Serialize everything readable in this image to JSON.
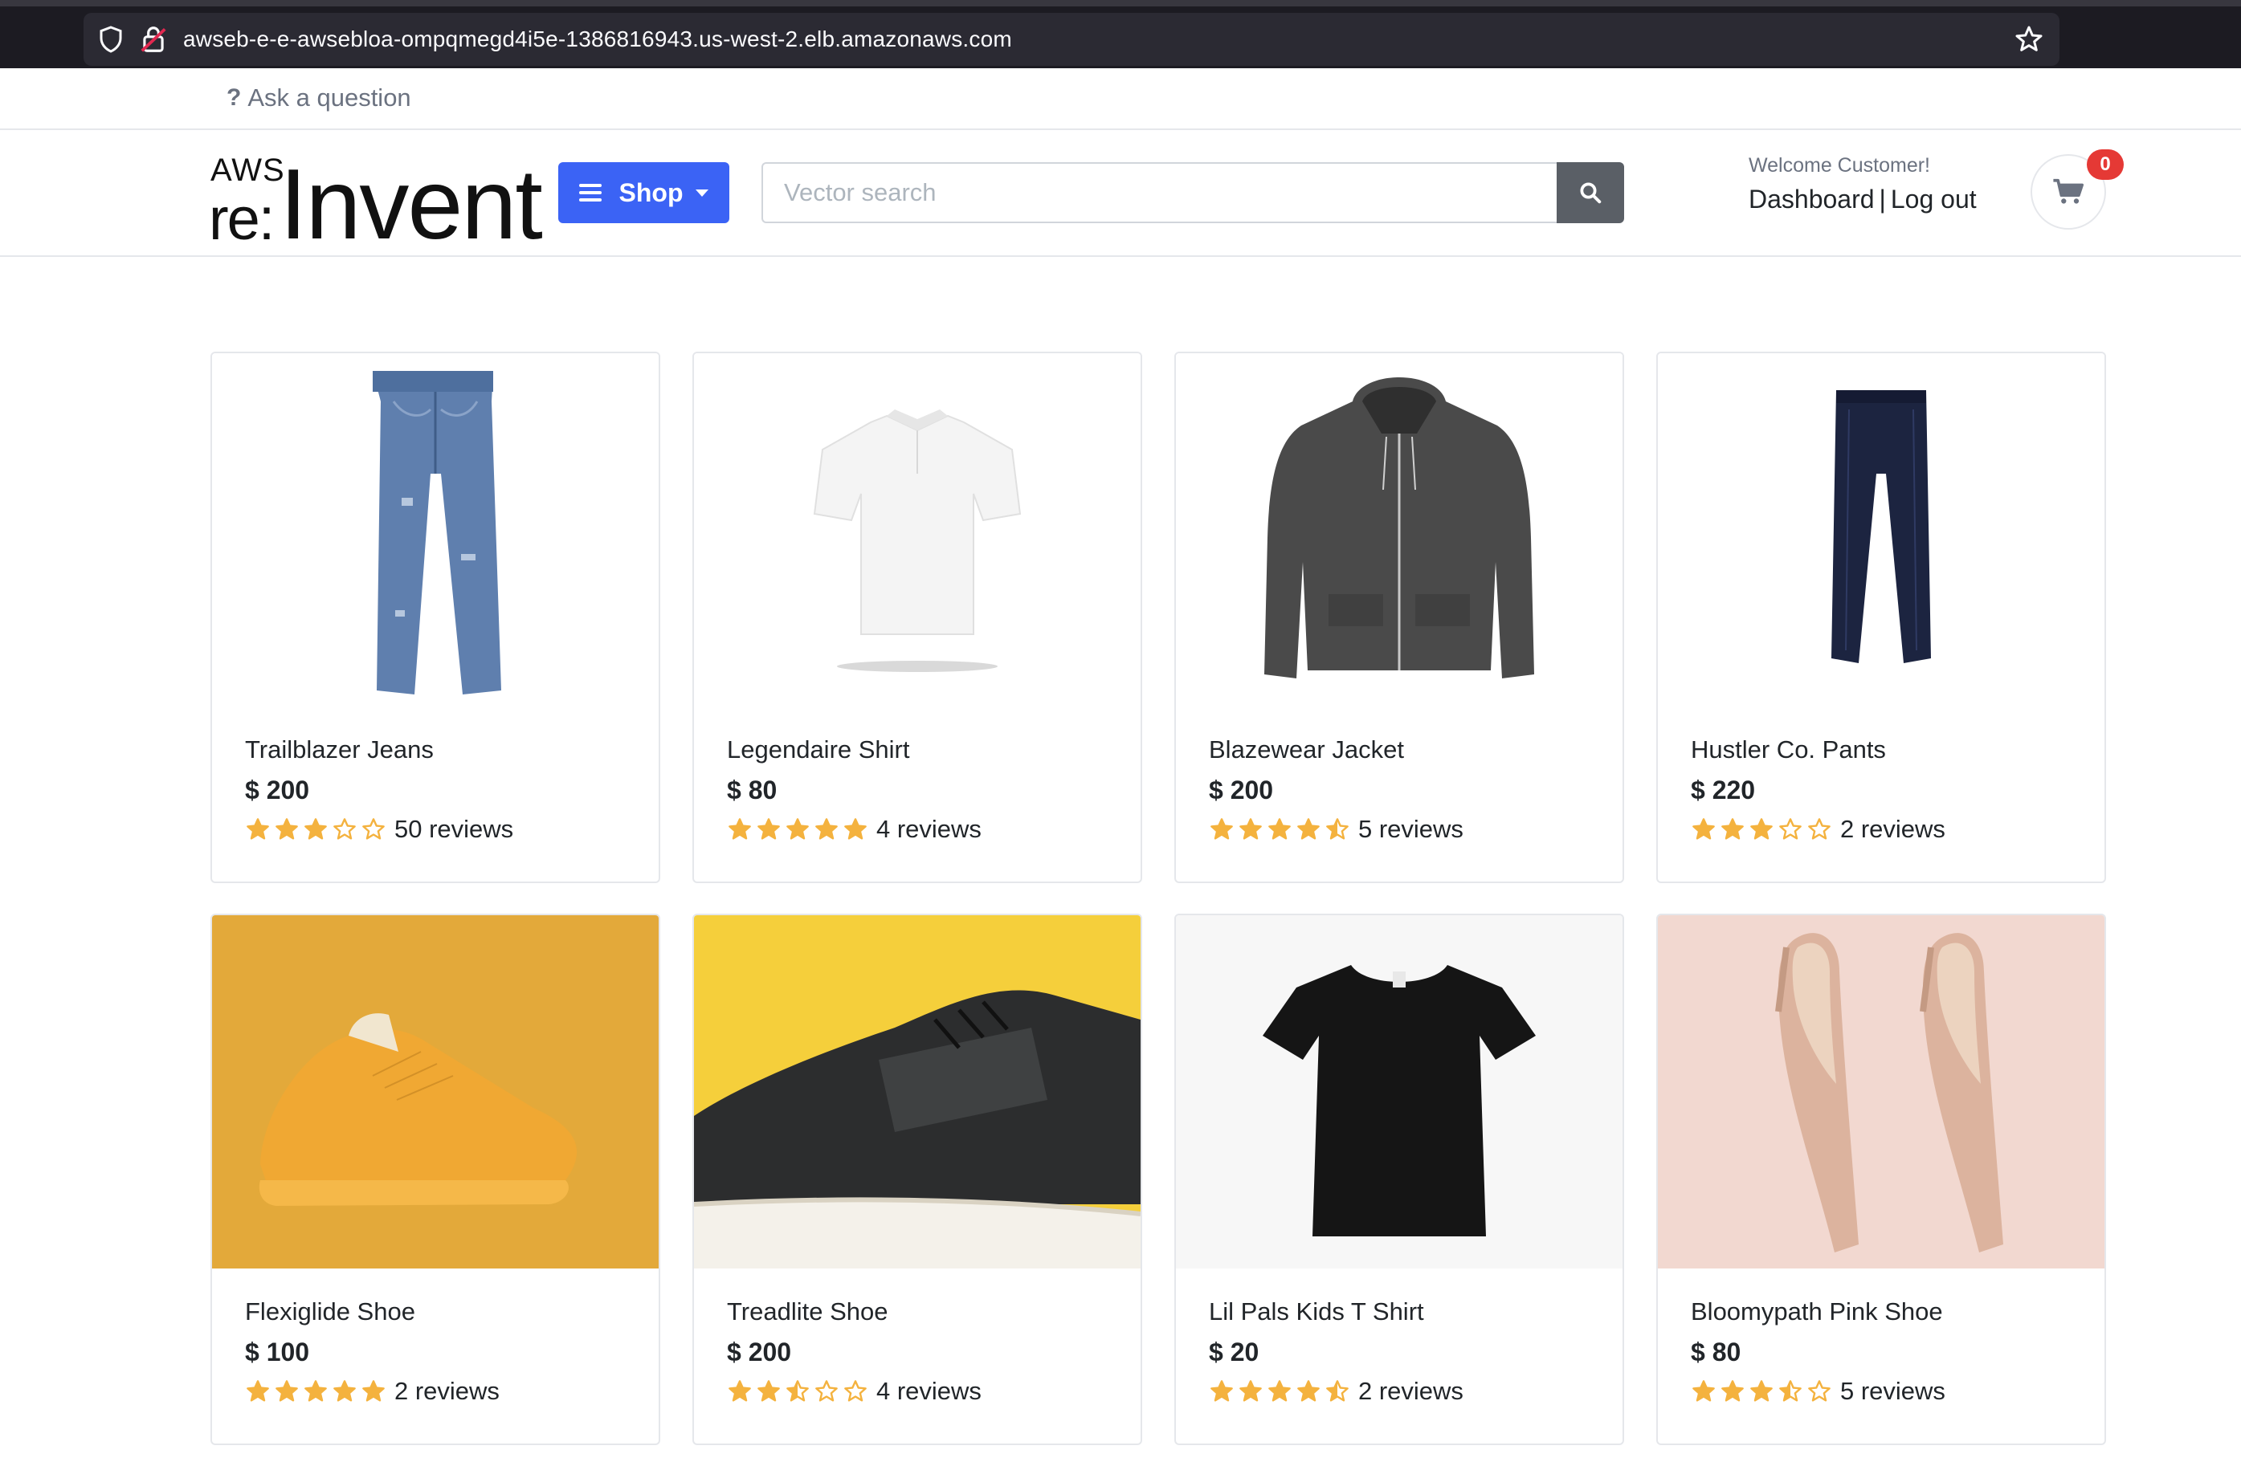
{
  "browser": {
    "url": "awseb-e-e-awsebloa-ompqmegd4i5e-1386816943.us-west-2.elb.amazonaws.com"
  },
  "topbar": {
    "ask_label": "Ask a question",
    "ask_icon": "question-icon"
  },
  "header": {
    "logo": {
      "aws": "AWS",
      "re": "re:",
      "invent": "Invent"
    },
    "shop_label": "Shop",
    "search_placeholder": "Vector search",
    "welcome": "Welcome Customer!",
    "dashboard_label": "Dashboard",
    "separator": "|",
    "logout_label": "Log out",
    "cart_count": "0"
  },
  "colors": {
    "accent": "#3b63f5",
    "star": "#f4b23e",
    "badge": "#e53935",
    "search_button": "#5a5f66"
  },
  "products": [
    {
      "name": "Trailblazer Jeans",
      "price": "$ 200",
      "rating": 3,
      "reviews": "50 reviews",
      "image": "jeans"
    },
    {
      "name": "Legendaire Shirt",
      "price": "$ 80",
      "rating": 5,
      "reviews": "4 reviews",
      "image": "polo-shirt"
    },
    {
      "name": "Blazewear Jacket",
      "price": "$ 200",
      "rating": 4.5,
      "reviews": "5 reviews",
      "image": "hoodie-jacket"
    },
    {
      "name": "Hustler Co. Pants",
      "price": "$ 220",
      "rating": 3,
      "reviews": "2 reviews",
      "image": "dress-pants"
    },
    {
      "name": "Flexiglide Shoe",
      "price": "$ 100",
      "rating": 5,
      "reviews": "2 reviews",
      "image": "yellow-sneaker"
    },
    {
      "name": "Treadlite Shoe",
      "price": "$ 200",
      "rating": 2.5,
      "reviews": "4 reviews",
      "image": "black-running-shoe"
    },
    {
      "name": "Lil Pals Kids T Shirt",
      "price": "$ 20",
      "rating": 4.5,
      "reviews": "2 reviews",
      "image": "black-tshirt"
    },
    {
      "name": "Bloomypath Pink Shoe",
      "price": "$ 80",
      "rating": 3.5,
      "reviews": "5 reviews",
      "image": "pink-heels"
    }
  ]
}
